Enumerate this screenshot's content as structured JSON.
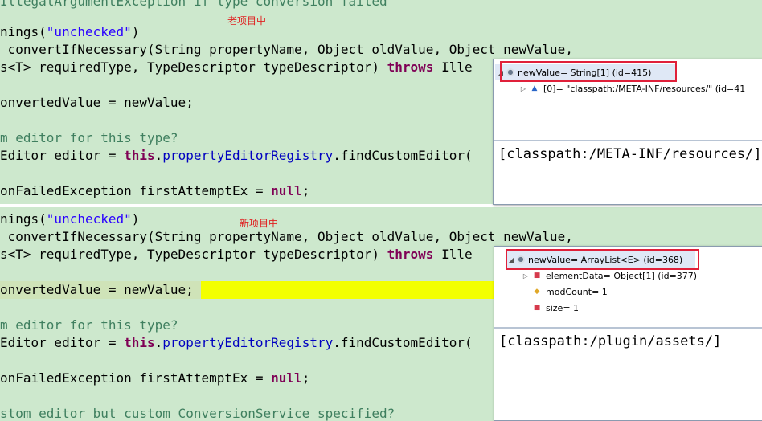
{
  "top_code": {
    "line0": "IllegalArgumentException if type conversion failed",
    "line1_pre": "nings(",
    "line1_str": "\"unchecked\"",
    "line1_post": ")",
    "line2": " convertIfNecessary(String propertyName, Object oldValue, Object newValue,",
    "line3_pre": "s<T> requiredType, TypeDescriptor typeDescriptor) ",
    "line3_kw": "throws",
    "line3_post": " Ille",
    "line4": "onvertedValue = newValue;",
    "line5": "m editor for this type?",
    "line6_pre": "Editor editor = ",
    "line6_kw": "this",
    "line6_dot": ".",
    "line6_field": "propertyEditorRegistry",
    "line6_post": ".findCustomEditor(",
    "line7_pre": "onFailedException firstAttemptEx = ",
    "line7_kw": "null",
    "line7_post": ";",
    "annotation": "老项目中"
  },
  "bottom_code": {
    "line1_pre": "nings(",
    "line1_str": "\"unchecked\"",
    "line1_post": ")",
    "line2": " convertIfNecessary(String propertyName, Object oldValue, Object newValue,",
    "line3_pre": "s<T> requiredType, TypeDescriptor typeDescriptor) ",
    "line3_kw": "throws",
    "line3_post": " Ille",
    "line4": "onvertedValue = newValue;",
    "line5": "m editor for this type?",
    "line6_pre": "Editor editor = ",
    "line6_kw": "this",
    "line6_dot": ".",
    "line6_field": "propertyEditorRegistry",
    "line6_post": ".findCustomEditor(",
    "line7_pre": "onFailedException firstAttemptEx = ",
    "line7_kw": "null",
    "line7_post": ";",
    "line8": "stom editor but custom ConversionService specified?",
    "annotation": "新项目中"
  },
  "top_popup": {
    "root": "newValue= String[1]  (id=415)",
    "child0": "[0]= \"classpath:/META-INF/resources/\" (id=41",
    "detail": "[classpath:/META-INF/resources/]"
  },
  "bottom_popup": {
    "root": "newValue= ArrayList<E>  (id=368)",
    "child0": "elementData= Object[1]  (id=377)",
    "child1": "modCount= 1",
    "child2": "size= 1",
    "detail": "[classpath:/plugin/assets/]"
  },
  "colors": {
    "editor_bg": "#cde8cd",
    "keyword": "#7f0055",
    "string": "#2a00ff",
    "comment": "#3f7f5f",
    "field": "#0000c0",
    "highlight": "#f3ff00",
    "annotation": "#e02020"
  },
  "icons": {
    "expanded": "triangle-down-icon",
    "collapsed": "triangle-right-icon",
    "object": "object-instance-icon",
    "array_element": "blue-triangle-icon",
    "private_field": "red-square-icon",
    "protected_field": "yellow-diamond-icon"
  }
}
